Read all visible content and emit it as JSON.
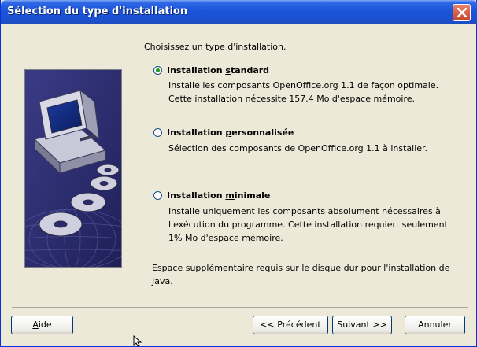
{
  "window": {
    "title": "Sélection du type d'installation"
  },
  "main": {
    "prompt": "Choisissez un type d'installation.",
    "options": [
      {
        "label_pre": "Installation ",
        "label_key": "s",
        "label_post": "tandard",
        "selected": true,
        "desc_lines": [
          "Installe les composants OpenOffice.org 1.1 de façon optimale.",
          "Cette installation nécessite 157.4 Mo d'espace mémoire."
        ]
      },
      {
        "label_pre": "Installation ",
        "label_key": "p",
        "label_post": "ersonnalisée",
        "selected": false,
        "desc_lines": [
          "Sélection des composants de OpenOffice.org 1.1 à installer."
        ]
      },
      {
        "label_pre": "Installation ",
        "label_key": "m",
        "label_post": "inimale",
        "selected": false,
        "desc_lines": [
          "Installe uniquement les composants absolument nécessaires à",
          "l'exécution du programme. Cette installation requiert seulement",
          "1% Mo d'espace mémoire."
        ]
      }
    ],
    "note_lines": [
      "Espace supplémentaire requis sur le disque dur pour l'installation de",
      "Java."
    ]
  },
  "buttons": {
    "help_key": "A",
    "help_rest": "ide",
    "previous": "<< Précédent",
    "next": "Suivant >>",
    "cancel": "Annuler"
  },
  "icons": {
    "close": "close-icon",
    "illustration": "computer-with-discs-illustration",
    "cursor": "mouse-cursor-icon"
  },
  "colors": {
    "titlebar": "#1c55d9",
    "dialog_bg": "#ece9d8",
    "radio_dot": "#21a121",
    "illustration_bg": "#2b2c6e"
  }
}
